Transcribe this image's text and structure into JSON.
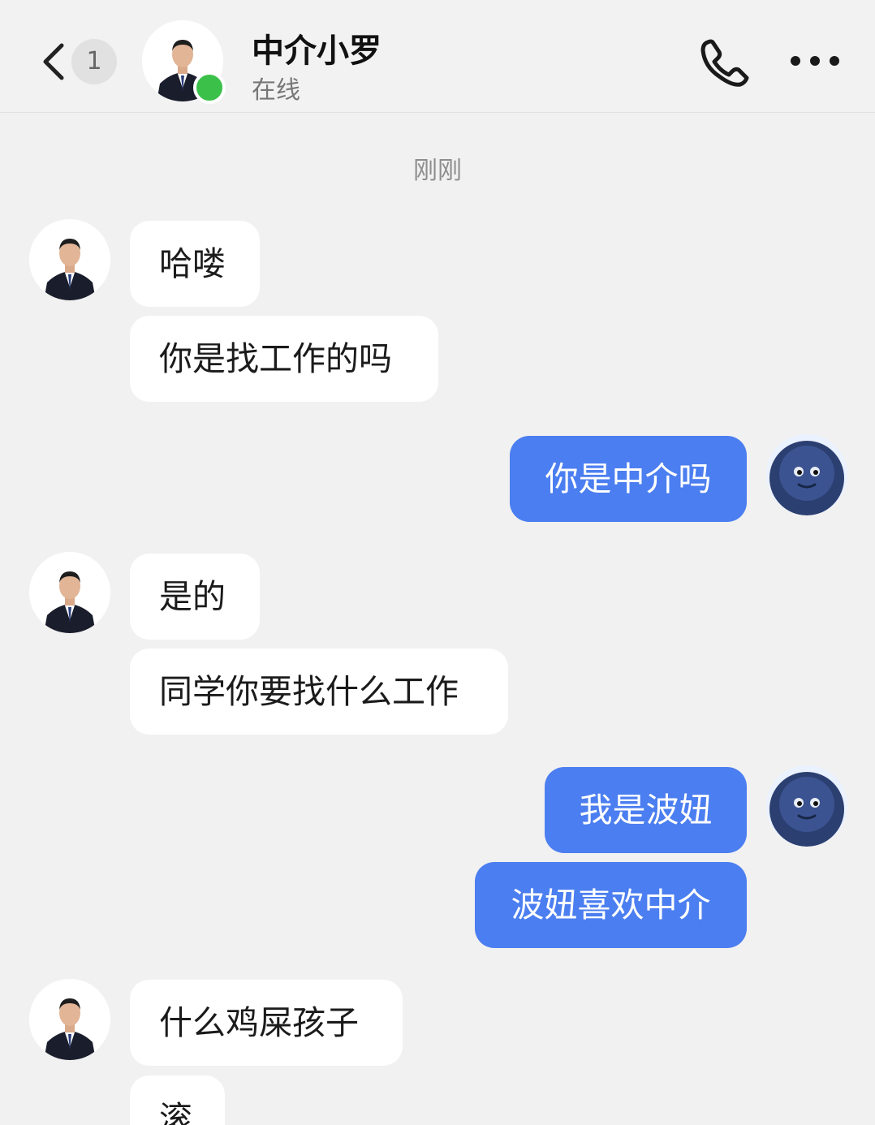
{
  "header": {
    "unread_count": "1",
    "contact_name": "中介小罗",
    "status": "在线"
  },
  "timestamp": "刚刚",
  "messages": [
    {
      "side": "in",
      "text": "哈喽"
    },
    {
      "side": "in",
      "text": "你是找工作的吗"
    },
    {
      "side": "out",
      "text": "你是中介吗"
    },
    {
      "side": "in",
      "text": "是的"
    },
    {
      "side": "in",
      "text": "同学你要找什么工作"
    },
    {
      "side": "out",
      "text": "我是波妞"
    },
    {
      "side": "out",
      "text": "波妞喜欢中介"
    },
    {
      "side": "in",
      "text": "什么鸡屎孩子"
    },
    {
      "side": "in",
      "text": "滚"
    }
  ],
  "colors": {
    "background": "#f1f1f1",
    "incoming_bubble": "#ffffff",
    "outgoing_bubble": "#4b7ef0",
    "online": "#3bc14a"
  }
}
